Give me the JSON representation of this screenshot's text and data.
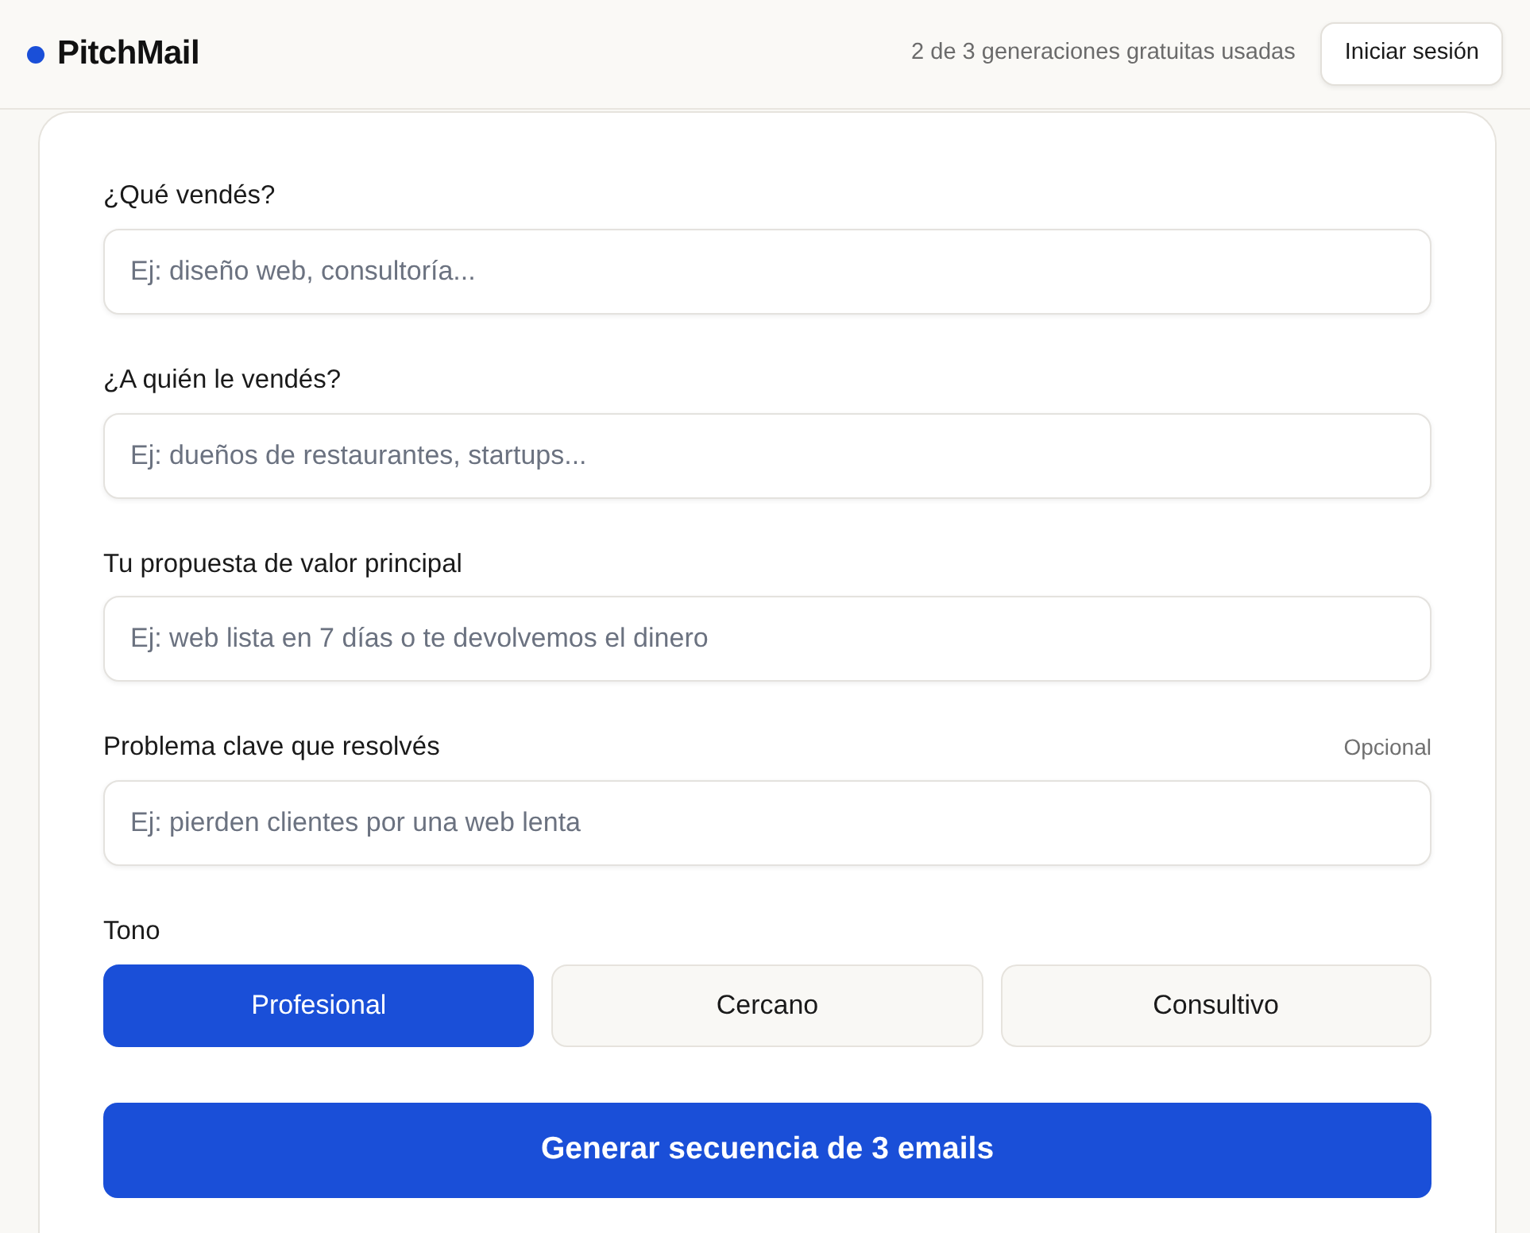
{
  "header": {
    "brand": "PitchMail",
    "usage": "2 de 3 generaciones gratuitas usadas",
    "login_button": "Iniciar sesión"
  },
  "form": {
    "fields": [
      {
        "label": "¿Qué vendés?",
        "placeholder": "Ej: diseño web, consultoría..."
      },
      {
        "label": "¿A quién le vendés?",
        "placeholder": "Ej: dueños de restaurantes, startups..."
      },
      {
        "label": "Tu propuesta de valor principal",
        "placeholder": "Ej: web lista en 7 días o te devolvemos el dinero"
      },
      {
        "label": "Problema clave que resolvés",
        "hint": "Opcional",
        "placeholder": "Ej: pierden clientes por una web lenta"
      }
    ],
    "tone": {
      "label": "Tono",
      "options": [
        {
          "label": "Profesional",
          "selected": true
        },
        {
          "label": "Cercano",
          "selected": false
        },
        {
          "label": "Consultivo",
          "selected": false
        }
      ]
    },
    "submit_button": "Generar secuencia de 3 emails"
  }
}
